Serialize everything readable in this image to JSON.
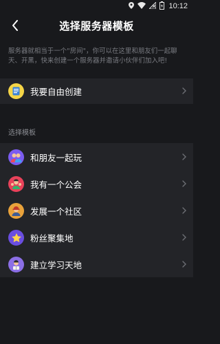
{
  "status": {
    "time": "10:12"
  },
  "header": {
    "title": "选择服务器模板"
  },
  "description": "服务器就相当于一个\"房间\"，你可以在这里和朋友们一起聊天、开黑，快来创建一个服务器并邀请小伙伴们加入吧!",
  "custom": {
    "label": "我要自由创建",
    "icon": "notepad-icon"
  },
  "section_label": "选择模板",
  "templates": [
    {
      "label": "和朋友一起玩",
      "icon": "friends-avatar-icon"
    },
    {
      "label": "我有一个公会",
      "icon": "guild-avatar-icon"
    },
    {
      "label": "发展一个社区",
      "icon": "community-avatar-icon"
    },
    {
      "label": "粉丝聚集地",
      "icon": "star-fan-icon"
    },
    {
      "label": "建立学习天地",
      "icon": "study-avatar-icon"
    }
  ],
  "colors": {
    "background": "#18191c",
    "row": "#232428",
    "muted": "#7a7c82"
  }
}
